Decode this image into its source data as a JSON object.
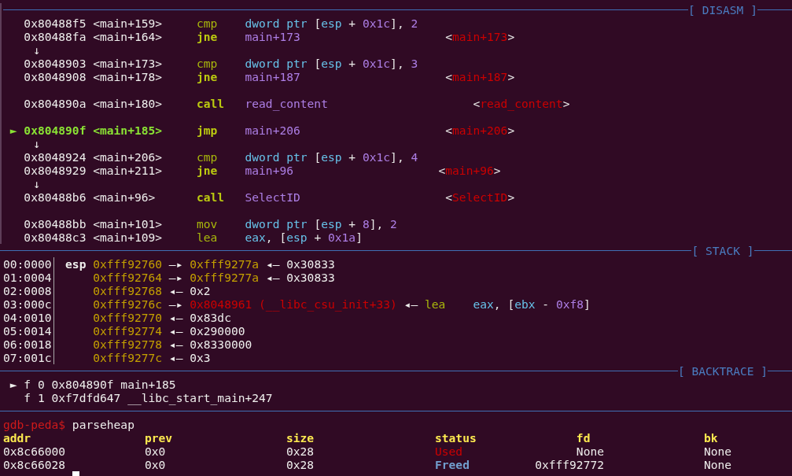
{
  "disasm": {
    "title": "[ DISASM ]",
    "current_marker": "►",
    "lines": [
      {
        "kind": "instruction",
        "address": "0x80488f5",
        "symbol": "<main+159>",
        "mnemonic": "cmp",
        "operands": "dword ptr [esp + 0x1c], 2",
        "branch": false,
        "selected": false
      },
      {
        "kind": "instruction",
        "address": "0x80488fa",
        "symbol": "<main+164>",
        "mnemonic": "jne",
        "operands": "main+173",
        "annotation": "<main+173>",
        "branch": true,
        "selected": false
      },
      {
        "kind": "arrow",
        "text": "↓"
      },
      {
        "kind": "instruction",
        "address": "0x8048903",
        "symbol": "<main+173>",
        "mnemonic": "cmp",
        "operands": "dword ptr [esp + 0x1c], 3",
        "branch": false,
        "selected": false
      },
      {
        "kind": "instruction",
        "address": "0x8048908",
        "symbol": "<main+178>",
        "mnemonic": "jne",
        "operands": "main+187",
        "annotation": "<main+187>",
        "branch": true,
        "selected": false
      },
      {
        "kind": "blank"
      },
      {
        "kind": "instruction",
        "address": "0x804890a",
        "symbol": "<main+180>",
        "mnemonic": "call",
        "operands": "read_content",
        "annotation": "<read_content>",
        "branch": true,
        "selected": false
      },
      {
        "kind": "blank"
      },
      {
        "kind": "instruction",
        "address": "0x804890f",
        "symbol": "<main+185>",
        "mnemonic": "jmp",
        "operands": "main+206",
        "annotation": "<main+206>",
        "branch": true,
        "selected": true
      },
      {
        "kind": "arrow",
        "text": "↓"
      },
      {
        "kind": "instruction",
        "address": "0x8048924",
        "symbol": "<main+206>",
        "mnemonic": "cmp",
        "operands": "dword ptr [esp + 0x1c], 4",
        "branch": false,
        "selected": false
      },
      {
        "kind": "instruction",
        "address": "0x8048929",
        "symbol": "<main+211>",
        "mnemonic": "jne",
        "operands": "main+96",
        "annotation": "<main+96>",
        "branch": true,
        "selected": false
      },
      {
        "kind": "arrow",
        "text": "↓"
      },
      {
        "kind": "instruction",
        "address": "0x80488b6",
        "symbol": "<main+96>",
        "mnemonic": "call",
        "operands": "SelectID",
        "annotation": "<SelectID>",
        "branch": true,
        "selected": false
      },
      {
        "kind": "blank"
      },
      {
        "kind": "instruction",
        "address": "0x80488bb",
        "symbol": "<main+101>",
        "mnemonic": "mov",
        "operands": "dword ptr [esp + 8], 2",
        "branch": false,
        "selected": false
      },
      {
        "kind": "instruction",
        "address": "0x80488c3",
        "symbol": "<main+109>",
        "mnemonic": "lea",
        "operands": "eax, [esp + 0x1a]",
        "branch": false,
        "selected": false
      }
    ]
  },
  "stack": {
    "title": "[ STACK ]",
    "rows": [
      {
        "offset": "00:0000",
        "register": "esp",
        "chain": [
          {
            "kind": "address",
            "text": "0xfff92760"
          },
          {
            "kind": "arrow",
            "text": "—▸"
          },
          {
            "kind": "address",
            "text": "0xfff9277a"
          },
          {
            "kind": "arrow",
            "text": "◂—"
          },
          {
            "kind": "value",
            "text": "0x30833"
          }
        ]
      },
      {
        "offset": "01:0004",
        "chain": [
          {
            "kind": "address",
            "text": "0xfff92764"
          },
          {
            "kind": "arrow",
            "text": "—▸"
          },
          {
            "kind": "address",
            "text": "0xfff9277a"
          },
          {
            "kind": "arrow",
            "text": "◂—"
          },
          {
            "kind": "value",
            "text": "0x30833"
          }
        ]
      },
      {
        "offset": "02:0008",
        "chain": [
          {
            "kind": "address",
            "text": "0xfff92768"
          },
          {
            "kind": "arrow",
            "text": "◂—"
          },
          {
            "kind": "value",
            "text": "0x2"
          }
        ]
      },
      {
        "offset": "03:000c",
        "chain": [
          {
            "kind": "address",
            "text": "0xfff9276c"
          },
          {
            "kind": "arrow",
            "text": "—▸"
          },
          {
            "kind": "code",
            "text": "0x8048961 (__libc_csu_init+33)"
          },
          {
            "kind": "arrow",
            "text": "◂—"
          },
          {
            "kind": "instruction",
            "mnemonic": "lea",
            "operands": "eax, [ebx - 0xf8]"
          }
        ]
      },
      {
        "offset": "04:0010",
        "chain": [
          {
            "kind": "address",
            "text": "0xfff92770"
          },
          {
            "kind": "arrow",
            "text": "◂—"
          },
          {
            "kind": "value",
            "text": "0x83dc"
          }
        ]
      },
      {
        "offset": "05:0014",
        "chain": [
          {
            "kind": "address",
            "text": "0xfff92774"
          },
          {
            "kind": "arrow",
            "text": "◂—"
          },
          {
            "kind": "value",
            "text": "0x290000"
          }
        ]
      },
      {
        "offset": "06:0018",
        "chain": [
          {
            "kind": "address",
            "text": "0xfff92778"
          },
          {
            "kind": "arrow",
            "text": "◂—"
          },
          {
            "kind": "value",
            "text": "0x8330000"
          }
        ]
      },
      {
        "offset": "07:001c",
        "chain": [
          {
            "kind": "address",
            "text": "0xfff9277c"
          },
          {
            "kind": "arrow",
            "text": "◂—"
          },
          {
            "kind": "value",
            "text": "0x3"
          }
        ]
      }
    ]
  },
  "backtrace": {
    "title": "[ BACKTRACE ]",
    "current_marker": "►",
    "frames": [
      {
        "index": "f 0",
        "address": "0x804890f",
        "symbol": "main+185",
        "selected": true
      },
      {
        "index": "f 1",
        "address": "0xf7dfd647",
        "symbol": "__libc_start_main+247",
        "selected": false
      }
    ]
  },
  "heap": {
    "prompt": "gdb-peda$",
    "command": "parseheap",
    "columns": [
      "addr",
      "prev",
      "size",
      "status",
      "fd",
      "bk"
    ],
    "rows": [
      {
        "addr": "0x8c66000",
        "prev": "0x0",
        "size": "0x28",
        "status": {
          "text": "Used",
          "color": "#cc0000",
          "bold": false
        },
        "fd": "None",
        "bk": "None"
      },
      {
        "addr": "0x8c66028",
        "prev": "0x0",
        "size": "0x28",
        "status": {
          "text": "Freed",
          "color": "#729fcf",
          "bold": true
        },
        "fd": "0xfff92772",
        "bk": "None"
      }
    ]
  }
}
